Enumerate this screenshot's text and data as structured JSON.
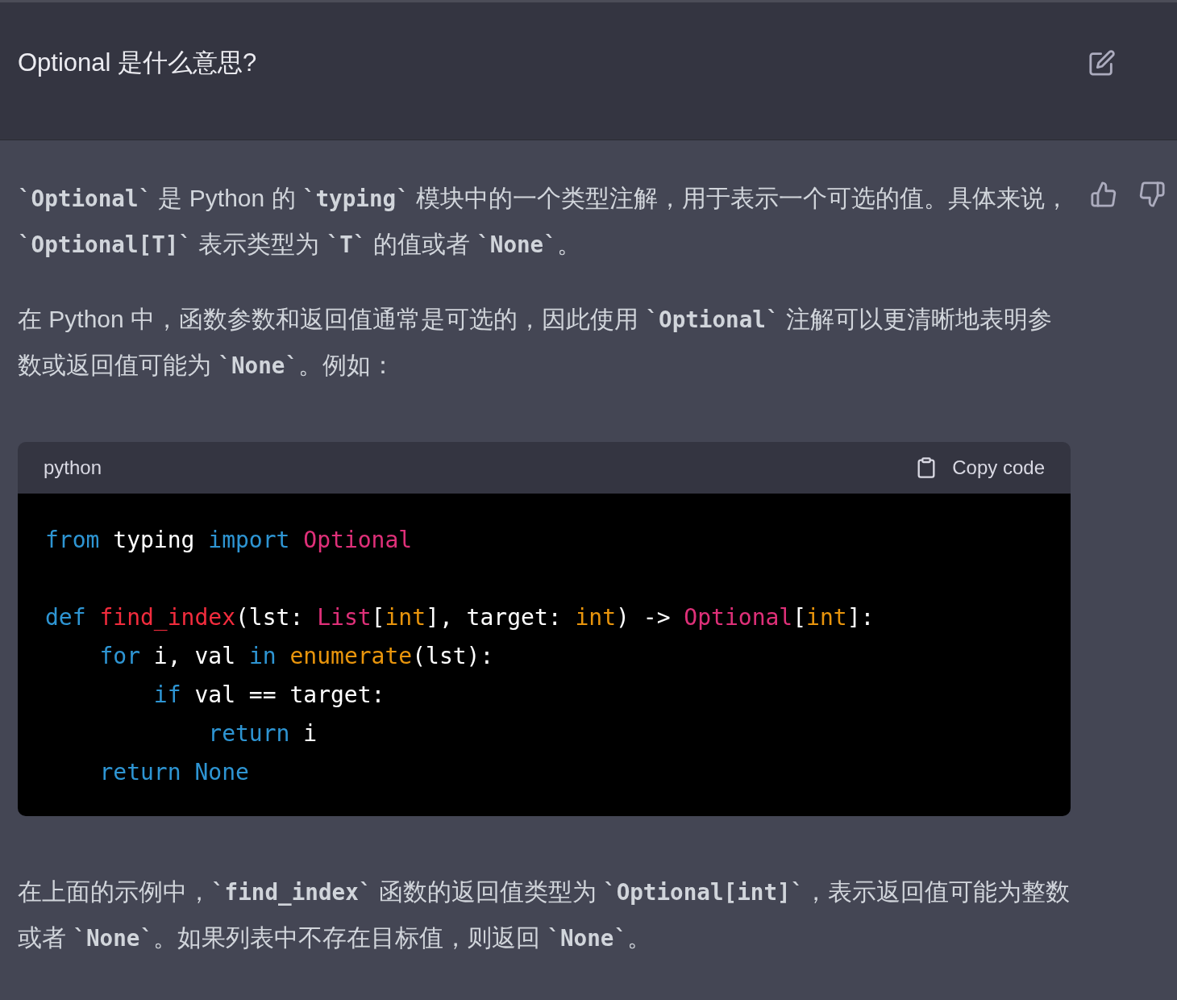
{
  "question": {
    "text": "Optional 是什么意思?"
  },
  "answer": {
    "paragraphs_before": [
      "**`Optional`** 是 Python 的 **`typing`** 模块中的一个类型注解，用于表示一个可选的值。具体来说，**`Optional[T]`** 表示类型为 **`T`** 的值或者 **`None`**。",
      "在 Python 中，函数参数和返回值通常是可选的，因此使用 **`Optional`** 注解可以更清晰地表明参数或返回值可能为 **`None`**。例如："
    ],
    "code": {
      "language": "python",
      "copy_label": "Copy code",
      "blocks": [
        [
          [
            {
              "kind": "keyword",
              "text": "from"
            },
            {
              "kind": "plain",
              "text": " typing "
            },
            {
              "kind": "keyword",
              "text": "import"
            },
            {
              "kind": "class",
              "text": " Optional"
            }
          ]
        ],
        [
          [
            {
              "kind": "keyword",
              "text": "def"
            },
            {
              "kind": "function",
              "text": " find_index"
            },
            {
              "kind": "plain",
              "text": "(lst: "
            },
            {
              "kind": "class",
              "text": "List"
            },
            {
              "kind": "plain",
              "text": "["
            },
            {
              "kind": "builtin",
              "text": "int"
            },
            {
              "kind": "plain",
              "text": "], target: "
            },
            {
              "kind": "builtin",
              "text": "int"
            },
            {
              "kind": "plain",
              "text": ") -> "
            },
            {
              "kind": "class",
              "text": "Optional"
            },
            {
              "kind": "plain",
              "text": "["
            },
            {
              "kind": "builtin",
              "text": "int"
            },
            {
              "kind": "plain",
              "text": "]:"
            }
          ],
          [
            {
              "kind": "keyword",
              "text": "    for"
            },
            {
              "kind": "plain",
              "text": " i, val "
            },
            {
              "kind": "keyword",
              "text": "in"
            },
            {
              "kind": "builtin",
              "text": " enumerate"
            },
            {
              "kind": "plain",
              "text": "(lst):"
            }
          ],
          [
            {
              "kind": "keyword",
              "text": "        if"
            },
            {
              "kind": "plain",
              "text": " val == target:"
            }
          ],
          [
            {
              "kind": "keyword",
              "text": "            return"
            },
            {
              "kind": "plain",
              "text": " i"
            }
          ],
          [
            {
              "kind": "keyword",
              "text": "    return None"
            }
          ]
        ]
      ]
    },
    "paragraphs_after": [
      "在上面的示例中，**`find_index`** 函数的返回值类型为 **`Optional[int]`**，表示返回值可能为整数或者 **`None`**。如果列表中不存在目标值，则返回 **`None`**。"
    ]
  }
}
